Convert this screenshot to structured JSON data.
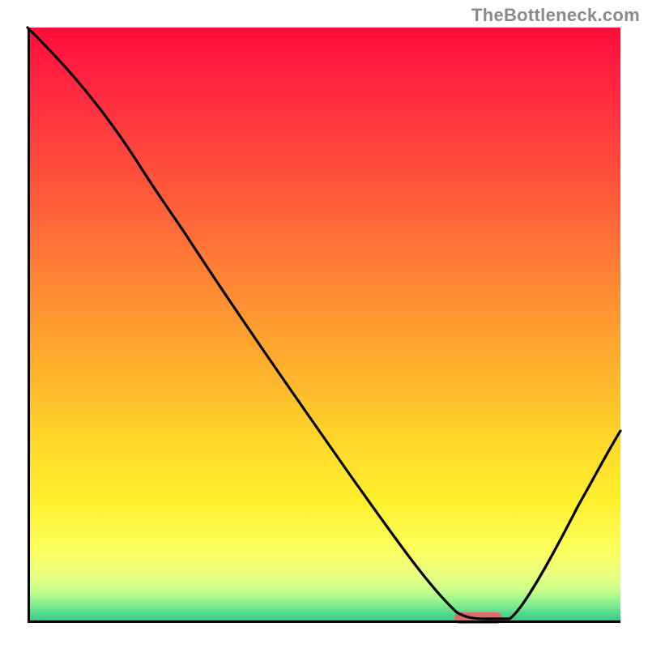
{
  "watermark": "TheBottleneck.com",
  "marker": {
    "color": "#d96c6c",
    "x_pct_start": 0.72,
    "x_pct_end": 0.8
  },
  "chart_data": {
    "type": "line",
    "title": "",
    "xlabel": "",
    "ylabel": "",
    "xlim": [
      0,
      1
    ],
    "ylim": [
      0,
      1
    ],
    "grid": false,
    "legend": false,
    "background_gradient": [
      "#ff0d3a",
      "#ff8c33",
      "#ffd82a",
      "#2ecf87"
    ],
    "series": [
      {
        "name": "bottleneck-curve",
        "color": "#000000",
        "x": [
          0.0,
          0.06,
          0.12,
          0.18,
          0.22,
          0.28,
          0.36,
          0.46,
          0.56,
          0.64,
          0.7,
          0.74,
          0.78,
          0.82,
          0.88,
          0.94,
          1.0
        ],
        "y": [
          1.0,
          0.94,
          0.87,
          0.78,
          0.72,
          0.63,
          0.5,
          0.36,
          0.22,
          0.12,
          0.04,
          0.005,
          0.005,
          0.02,
          0.1,
          0.2,
          0.32
        ]
      }
    ],
    "marker_region": {
      "shape": "pill",
      "color": "#d96c6c",
      "y_pct": 0.0,
      "x_pct_start": 0.72,
      "x_pct_end": 0.8
    },
    "notes": "x and y are normalized fractions of the plot area; y=1 is top, y=0 is bottom (axis). Curve starts top-left, descends to a minimum near x≈0.74–0.80, then rises again toward x=1."
  }
}
